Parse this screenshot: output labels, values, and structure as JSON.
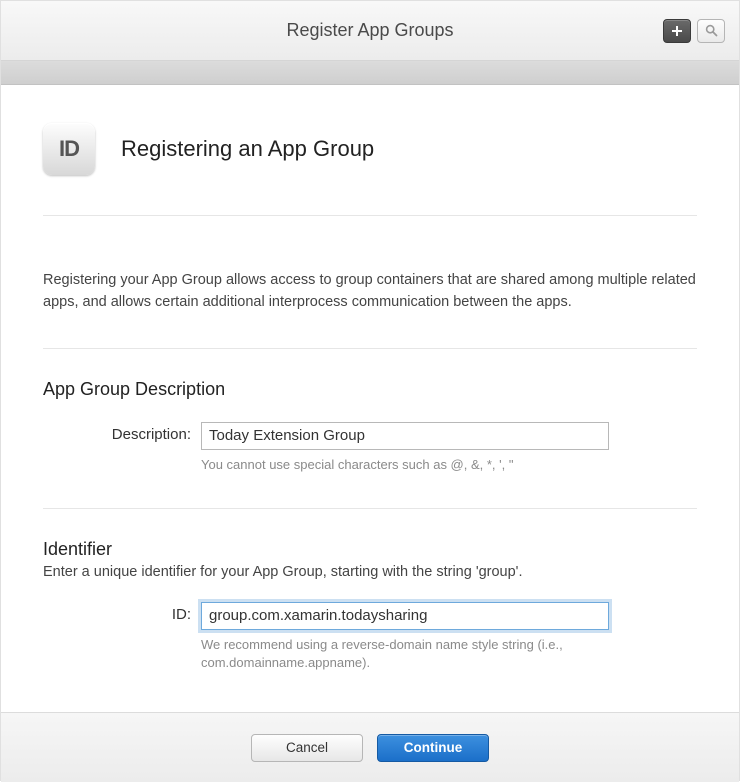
{
  "header": {
    "title": "Register App Groups"
  },
  "page": {
    "icon_text": "ID",
    "heading": "Registering an App Group",
    "intro": "Registering your App Group allows access to group containers that are shared among multiple related apps, and allows certain additional interprocess communication between the apps."
  },
  "description_section": {
    "title": "App Group Description",
    "label": "Description:",
    "value": "Today Extension Group",
    "hint": "You cannot use special characters such as @, &, *, ', \""
  },
  "identifier_section": {
    "title": "Identifier",
    "sub": "Enter a unique identifier for your App Group, starting with the string 'group'.",
    "label": "ID:",
    "value": "group.com.xamarin.todaysharing",
    "hint": "We recommend using a reverse-domain name style string (i.e., com.domainname.appname)."
  },
  "footer": {
    "cancel": "Cancel",
    "continue": "Continue"
  }
}
